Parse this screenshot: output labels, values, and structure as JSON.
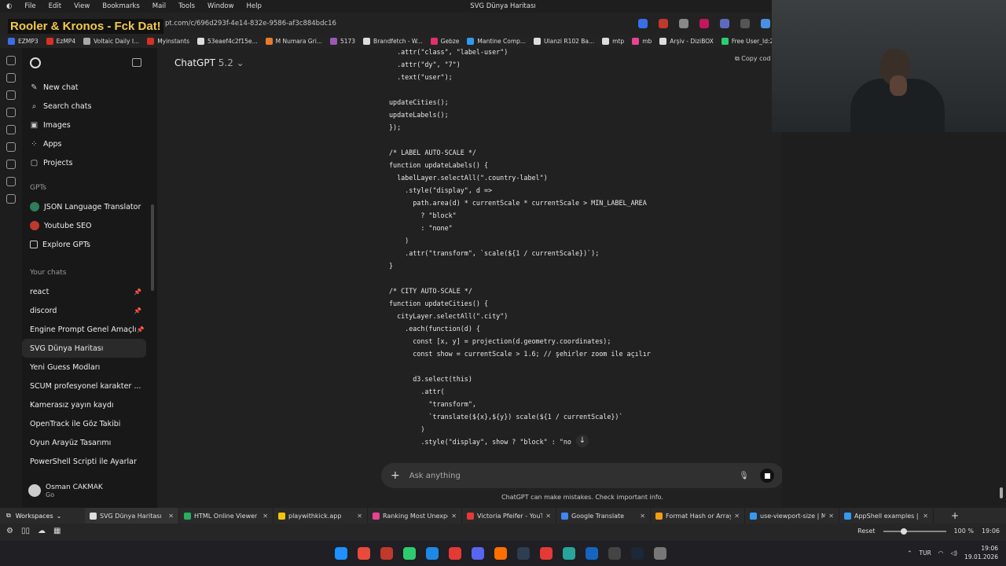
{
  "menubar": {
    "items": [
      "File",
      "Edit",
      "View",
      "Bookmarks",
      "Mail",
      "Tools",
      "Window",
      "Help"
    ],
    "window_title": "SVG Dünya Haritası"
  },
  "overlay_text": "Rooler & Kronos - Fck Dat!",
  "address": {
    "url": "pt.com/c/696d293f-4e14-832e-9586-af3c884bdc16"
  },
  "bookmarks": [
    {
      "label": "EZMP3",
      "color": "#3a6ee8"
    },
    {
      "label": "EzMP4",
      "color": "#d93025"
    },
    {
      "label": "Voltaic Daily I...",
      "color": "#aaaaaa"
    },
    {
      "label": "Myinstants",
      "color": "#d93025"
    },
    {
      "label": "53eaef4c2f15e...",
      "color": "#dddddd"
    },
    {
      "label": "M Numara Gri...",
      "color": "#e87a2a"
    },
    {
      "label": "5173",
      "color": "#9b59b6"
    },
    {
      "label": "Brandfetch - W...",
      "color": "#dddddd"
    },
    {
      "label": "Gebze",
      "color": "#e1306c"
    },
    {
      "label": "Mantine Comp...",
      "color": "#339af0"
    },
    {
      "label": "Ulanzi R102 Ba...",
      "color": "#dddddd"
    },
    {
      "label": "mtp",
      "color": "#dddddd"
    },
    {
      "label": "mb",
      "color": "#e84393"
    },
    {
      "label": "Arşiv - DiziBOX",
      "color": "#dddddd"
    },
    {
      "label": "Free User_Id:28...",
      "color": "#2ecc71"
    }
  ],
  "sidebar": {
    "nav": [
      {
        "label": "New chat",
        "icon": "✎"
      },
      {
        "label": "Search chats",
        "icon": "⌕"
      },
      {
        "label": "Images",
        "icon": "▣"
      },
      {
        "label": "Apps",
        "icon": "⁘"
      },
      {
        "label": "Projects",
        "icon": "▢"
      }
    ],
    "gpts_label": "GPTs",
    "gpts": [
      {
        "label": "JSON Language Translator",
        "color": "#2e7d5b"
      },
      {
        "label": "Youtube SEO",
        "color": "#c0392b"
      },
      {
        "label": "Explore GPTs",
        "color": ""
      }
    ],
    "your_chats_label": "Your chats",
    "chats": [
      {
        "label": "react",
        "pinned": true
      },
      {
        "label": "discord",
        "pinned": true
      },
      {
        "label": "Engine Prompt Genel Amaçlı",
        "pinned": true
      },
      {
        "label": "SVG Dünya Haritası",
        "pinned": false,
        "active": true
      },
      {
        "label": "Yeni Guess Modları",
        "pinned": false
      },
      {
        "label": "SCUM profesyonel karakter ...",
        "pinned": false
      },
      {
        "label": "Kamerasız yayın kaydı",
        "pinned": false
      },
      {
        "label": "OpenTrack ile Göz Takibi",
        "pinned": false
      },
      {
        "label": "Oyun Arayüz Tasarımı",
        "pinned": false
      },
      {
        "label": "PowerShell Scripti ile Ayarlar",
        "pinned": false
      }
    ],
    "user": {
      "name": "Osman CAKMAK",
      "plan": "Go"
    }
  },
  "main": {
    "model_name": "ChatGPT",
    "model_version": "5.2",
    "copy_code_label": "Copy cod",
    "code_lines": [
      "  .attr(\"class\", \"label-user\")",
      "  .attr(\"dy\", \"7\")",
      "  .text(\"user\");",
      "",
      "updateCities();",
      "updateLabels();",
      "});",
      "",
      "/* LABEL AUTO-SCALE */",
      "function updateLabels() {",
      "  labelLayer.selectAll(\".country-label\")",
      "    .style(\"display\", d =>",
      "      path.area(d) * currentScale * currentScale > MIN_LABEL_AREA",
      "        ? \"block\"",
      "        : \"none\"",
      "    )",
      "    .attr(\"transform\", `scale(${1 / currentScale})`);",
      "}",
      "",
      "/* CITY AUTO-SCALE */",
      "function updateCities() {",
      "  cityLayer.selectAll(\".city\")",
      "    .each(function(d) {",
      "      const [x, y] = projection(d.geometry.coordinates);",
      "      const show = currentScale > 1.6; // şehirler zoom ile açılır",
      "",
      "      d3.select(this)",
      "        .attr(",
      "          \"transform\",",
      "          `translate(${x},${y}) scale(${1 / currentScale})`",
      "        )",
      "        .style(\"display\", show ? \"block\" : \"no"
    ],
    "composer_placeholder": "Ask anything",
    "disclaimer": "ChatGPT can make mistakes. Check important info."
  },
  "tabbar": {
    "workspaces_label": "Workspaces",
    "tabs": [
      {
        "label": "SVG Dünya Haritası",
        "color": "#dddddd",
        "active": true
      },
      {
        "label": "HTML Online Viewer",
        "color": "#27ae60"
      },
      {
        "label": "playwithkick.app",
        "color": "#f1c40f"
      },
      {
        "label": "Ranking Most Unexpe",
        "color": "#e84393"
      },
      {
        "label": "Victoria Pfeifer - YouTu",
        "color": "#e53935"
      },
      {
        "label": "Google Translate",
        "color": "#4285f4"
      },
      {
        "label": "Format Hash or Array",
        "color": "#f39c12"
      },
      {
        "label": "use-viewport-size | Ma",
        "color": "#339af0"
      },
      {
        "label": "AppShell examples | M",
        "color": "#339af0"
      }
    ]
  },
  "statusbar": {
    "reset_label": "Reset",
    "zoom": "100 %",
    "time": "19:06"
  },
  "taskbar": {
    "icons": [
      "#1e90ff",
      "#e84b3c",
      "#c0392b",
      "#2ecc71",
      "#1e88e5",
      "#e53935",
      "#5865f2",
      "#ff6f00",
      "#2c3e50",
      "#e53935",
      "#26a69a",
      "#1565c0",
      "#444444",
      "#1b2838",
      "#777777"
    ],
    "lang": "TUR",
    "clock_time": "19:06",
    "clock_date": "19.01.2026"
  },
  "colors": {
    "accent": "#f2c94c",
    "background": "#212121",
    "sidebar": "#181818"
  }
}
